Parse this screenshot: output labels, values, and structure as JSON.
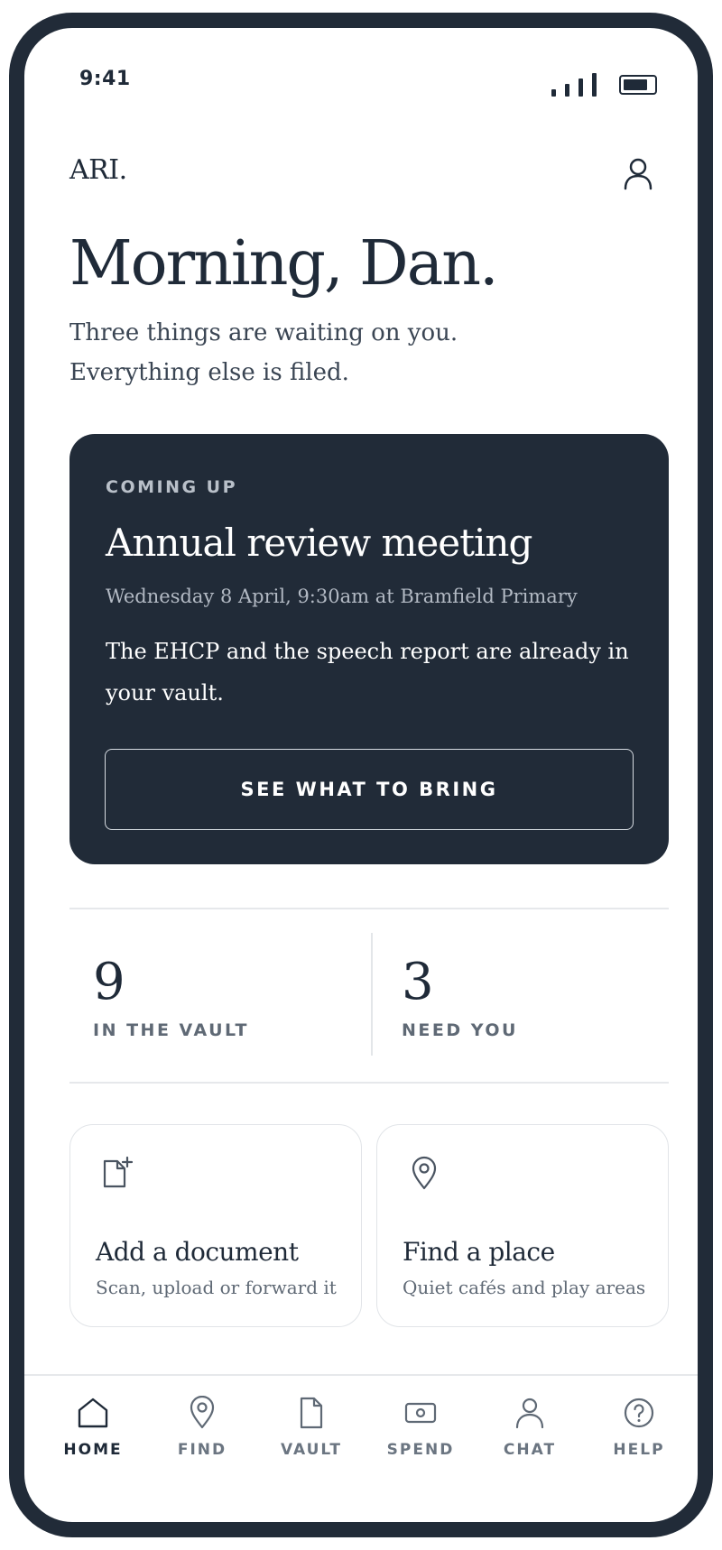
{
  "status_bar": {
    "time": "9:41"
  },
  "header": {
    "brand": "ARI."
  },
  "greeting": {
    "title": "Morning, Dan.",
    "subtitle": "Three things are waiting on you. Everything else is filed."
  },
  "coming_up": {
    "eyebrow": "COMING UP",
    "title": "Annual review meeting",
    "when": "Wednesday 8 April, 9:30am at Bramfield Primary",
    "body": "The EHCP and the speech report are already in your vault.",
    "cta_label": "SEE WHAT TO BRING"
  },
  "stats": [
    {
      "value": "9",
      "label": "IN THE VAULT"
    },
    {
      "value": "3",
      "label": "NEED YOU"
    }
  ],
  "actions": [
    {
      "title": "Add a document",
      "subtitle": "Scan, upload or forward it",
      "icon": "document-add-icon"
    },
    {
      "title": "Find a place",
      "subtitle": "Quiet cafés and play areas",
      "icon": "map-pin-icon"
    }
  ],
  "nav": [
    {
      "label": "HOME",
      "icon": "home-icon",
      "active": true
    },
    {
      "label": "FIND",
      "icon": "map-pin-icon"
    },
    {
      "label": "VAULT",
      "icon": "document-icon"
    },
    {
      "label": "SPEND",
      "icon": "money-icon"
    },
    {
      "label": "CHAT",
      "icon": "person-icon"
    },
    {
      "label": "HELP",
      "icon": "help-icon"
    }
  ],
  "colors": {
    "ink": "#1f2a38",
    "card": "#212b38",
    "muted": "#5f6975",
    "border": "#e1e4e8"
  }
}
